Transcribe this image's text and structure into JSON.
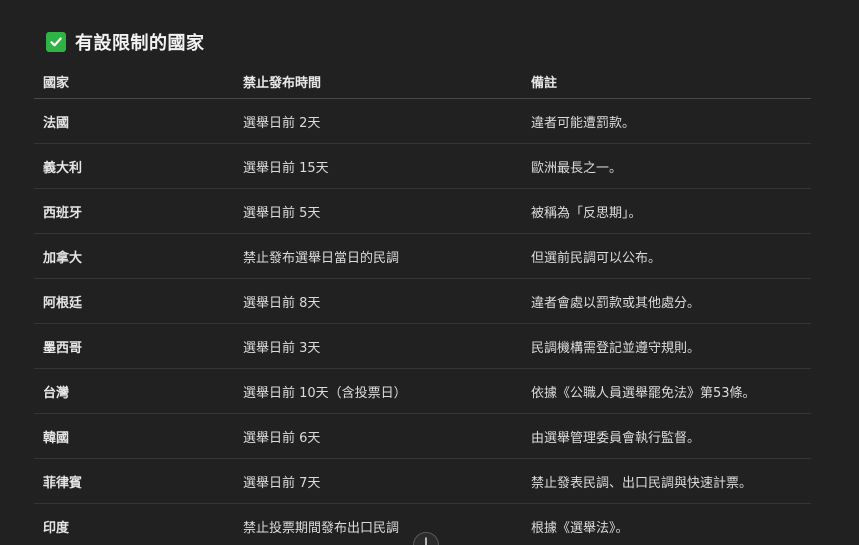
{
  "heading": {
    "icon": "check-box-icon",
    "title": "有設限制的國家",
    "icon_color": "#2fb344"
  },
  "table": {
    "columns": [
      "國家",
      "禁止發布時間",
      "備註"
    ],
    "rows": [
      {
        "country": "法國",
        "period": "選舉日前 2天",
        "note": "違者可能遭罰款。"
      },
      {
        "country": "義大利",
        "period": "選舉日前 15天",
        "note": "歐洲最長之一。"
      },
      {
        "country": "西班牙",
        "period": "選舉日前 5天",
        "note": "被稱為「反思期」。"
      },
      {
        "country": "加拿大",
        "period": "禁止發布選舉日當日的民調",
        "note": "但選前民調可以公布。"
      },
      {
        "country": "阿根廷",
        "period": "選舉日前 8天",
        "note": "違者會處以罰款或其他處分。"
      },
      {
        "country": "墨西哥",
        "period": "選舉日前 3天",
        "note": "民調機構需登記並遵守規則。"
      },
      {
        "country": "台灣",
        "period": "選舉日前 10天（含投票日）",
        "note": "依據《公職人員選舉罷免法》第53條。"
      },
      {
        "country": "韓國",
        "period": "選舉日前 6天",
        "note": "由選舉管理委員會執行監督。"
      },
      {
        "country": "菲律賓",
        "period": "選舉日前 7天",
        "note": "禁止發表民調、出口民調與快速計票。"
      },
      {
        "country": "印度",
        "period": "禁止投票期間發布出口民調",
        "note": "根據《選舉法》。"
      }
    ]
  },
  "scroll_button": {
    "icon": "arrow-down-icon"
  }
}
